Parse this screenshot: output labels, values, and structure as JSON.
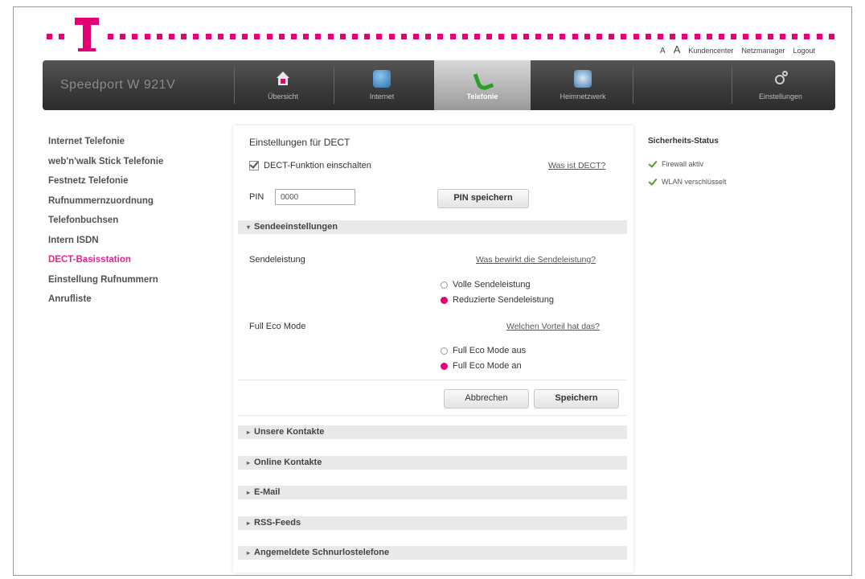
{
  "header": {
    "font_small": "A",
    "font_large": "A",
    "links": [
      "Kundencenter",
      "Netzmanager",
      "Logout"
    ],
    "brand_color": "#e20074"
  },
  "nav": {
    "device_name": "Speedport W 921V",
    "items": [
      {
        "label": "Übersicht",
        "icon": "home-icon"
      },
      {
        "label": "Internet",
        "icon": "globe-icon"
      },
      {
        "label": "Telefonie",
        "icon": "phone-icon",
        "active": true
      },
      {
        "label": "Heimnetzwerk",
        "icon": "home-network-icon"
      },
      {
        "label": "Einstellungen",
        "icon": "gear-icon"
      }
    ]
  },
  "sidebar": {
    "items": [
      {
        "label": "Internet Telefonie"
      },
      {
        "label": "web'n'walk Stick Telefonie"
      },
      {
        "label": "Festnetz Telefonie"
      },
      {
        "label": "Rufnummernzuordnung"
      },
      {
        "label": "Telefonbuchsen"
      },
      {
        "label": "Intern ISDN"
      },
      {
        "label": "DECT-Basisstation",
        "active": true
      },
      {
        "label": "Einstellung Rufnummern"
      },
      {
        "label": "Anrufliste"
      }
    ]
  },
  "main": {
    "title": "Einstellungen für DECT",
    "dect_checkbox_label": "DECT-Funktion einschalten",
    "dect_checked": true,
    "what_is_dect_link": "Was ist DECT?",
    "pin_label": "PIN",
    "pin_value": "0000",
    "pin_save_button": "PIN speichern",
    "send_section": "Sendeeinstellungen",
    "send_power_label": "Sendeleistung",
    "send_power_link": "Was bewirkt die Sendeleistung?",
    "send_options": [
      "Volle Sendeleistung",
      "Reduzierte Sendeleistung"
    ],
    "send_selected": 1,
    "eco_label": "Full Eco Mode",
    "eco_link": "Welchen Vorteil hat das?",
    "eco_options": [
      "Full Eco Mode aus",
      "Full Eco Mode an"
    ],
    "eco_selected": 1,
    "cancel_button": "Abbrechen",
    "save_button": "Speichern",
    "collapsed_sections": [
      "Unsere Kontakte",
      "Online Kontakte",
      "E-Mail",
      "RSS-Feeds",
      "Angemeldete Schnurlostelefone"
    ]
  },
  "status": {
    "title": "Sicherheits-Status",
    "items": [
      "Firewall aktiv",
      "WLAN verschlüsselt"
    ]
  }
}
